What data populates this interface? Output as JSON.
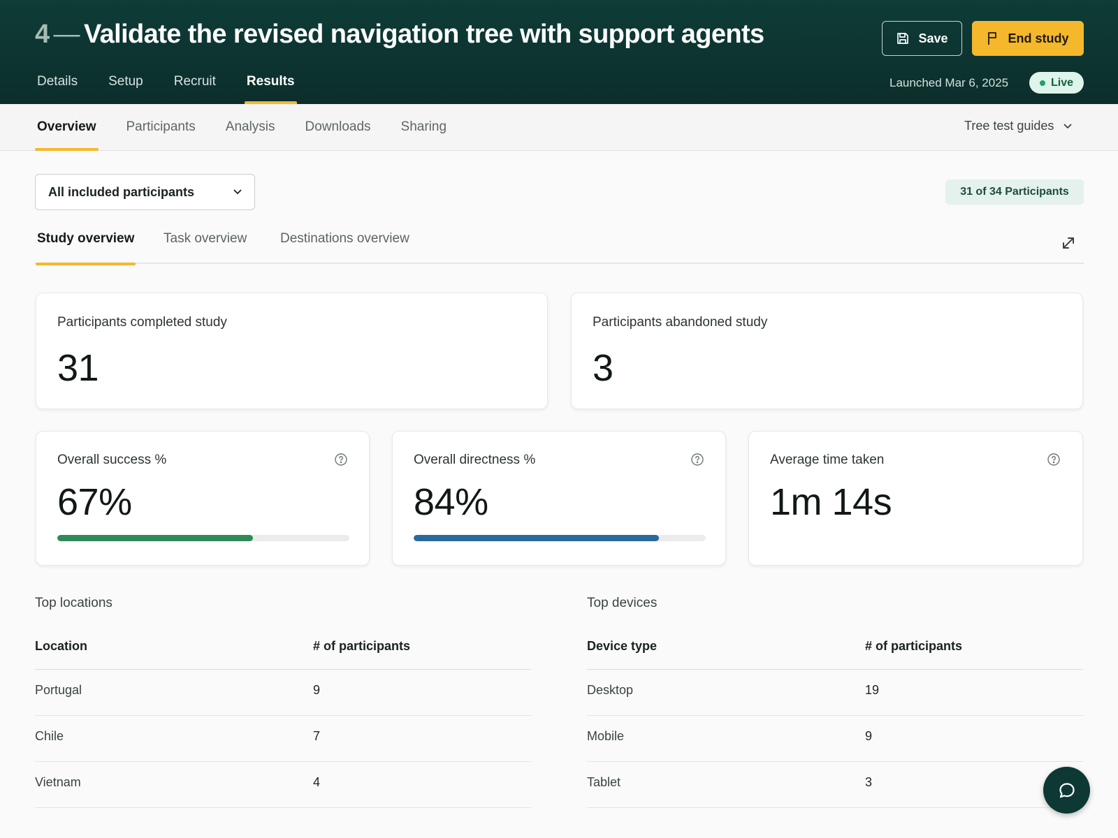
{
  "header": {
    "study_number": "4",
    "separator": "—",
    "study_title": "Validate the revised navigation tree with support agents",
    "save_label": "Save",
    "end_label": "End study",
    "tabs": [
      {
        "label": "Details"
      },
      {
        "label": "Setup"
      },
      {
        "label": "Recruit"
      },
      {
        "label": "Results",
        "active": true
      }
    ],
    "launched": "Launched Mar 6, 2025",
    "status": "Live"
  },
  "subnav": {
    "tabs": [
      {
        "label": "Overview",
        "active": true
      },
      {
        "label": "Participants"
      },
      {
        "label": "Analysis"
      },
      {
        "label": "Downloads"
      },
      {
        "label": "Sharing"
      }
    ],
    "guides_label": "Tree test guides"
  },
  "filter": {
    "selected": "All included participants",
    "count_label": "31 of 34 Participants"
  },
  "overview_tabs": [
    {
      "label": "Study overview",
      "active": true
    },
    {
      "label": "Task overview"
    },
    {
      "label": "Destinations overview"
    }
  ],
  "cards": {
    "completed": {
      "label": "Participants completed study",
      "value": "31"
    },
    "abandoned": {
      "label": "Participants abandoned study",
      "value": "3"
    },
    "success": {
      "label": "Overall success %",
      "value": "67%",
      "fraction": 0.67,
      "color": "#2e8b57"
    },
    "directness": {
      "label": "Overall directness %",
      "value": "84%",
      "fraction": 0.84,
      "color": "#2a68a0"
    },
    "time": {
      "label": "Average time taken",
      "value": "1m 14s"
    }
  },
  "locations": {
    "title": "Top locations",
    "headers": [
      "Location",
      "# of participants"
    ],
    "rows": [
      {
        "name": "Portugal",
        "count": "9"
      },
      {
        "name": "Chile",
        "count": "7"
      },
      {
        "name": "Vietnam",
        "count": "4"
      }
    ]
  },
  "devices": {
    "title": "Top devices",
    "headers": [
      "Device type",
      "# of participants"
    ],
    "rows": [
      {
        "name": "Desktop",
        "count": "19"
      },
      {
        "name": "Mobile",
        "count": "9"
      },
      {
        "name": "Tablet",
        "count": "3"
      }
    ]
  },
  "colors": {
    "header_bg": "#0e3c37",
    "accent": "#f5b72b",
    "live_bg": "#dff4ea",
    "success_bar": "#2e8b57",
    "directness_bar": "#2a68a0"
  },
  "icons": {
    "save": "save-icon",
    "end": "flag-icon",
    "guides": "chevron-down-icon",
    "filter": "chevron-down-icon",
    "expand": "expand-icon",
    "help": "help-icon",
    "chat": "chat-icon"
  }
}
